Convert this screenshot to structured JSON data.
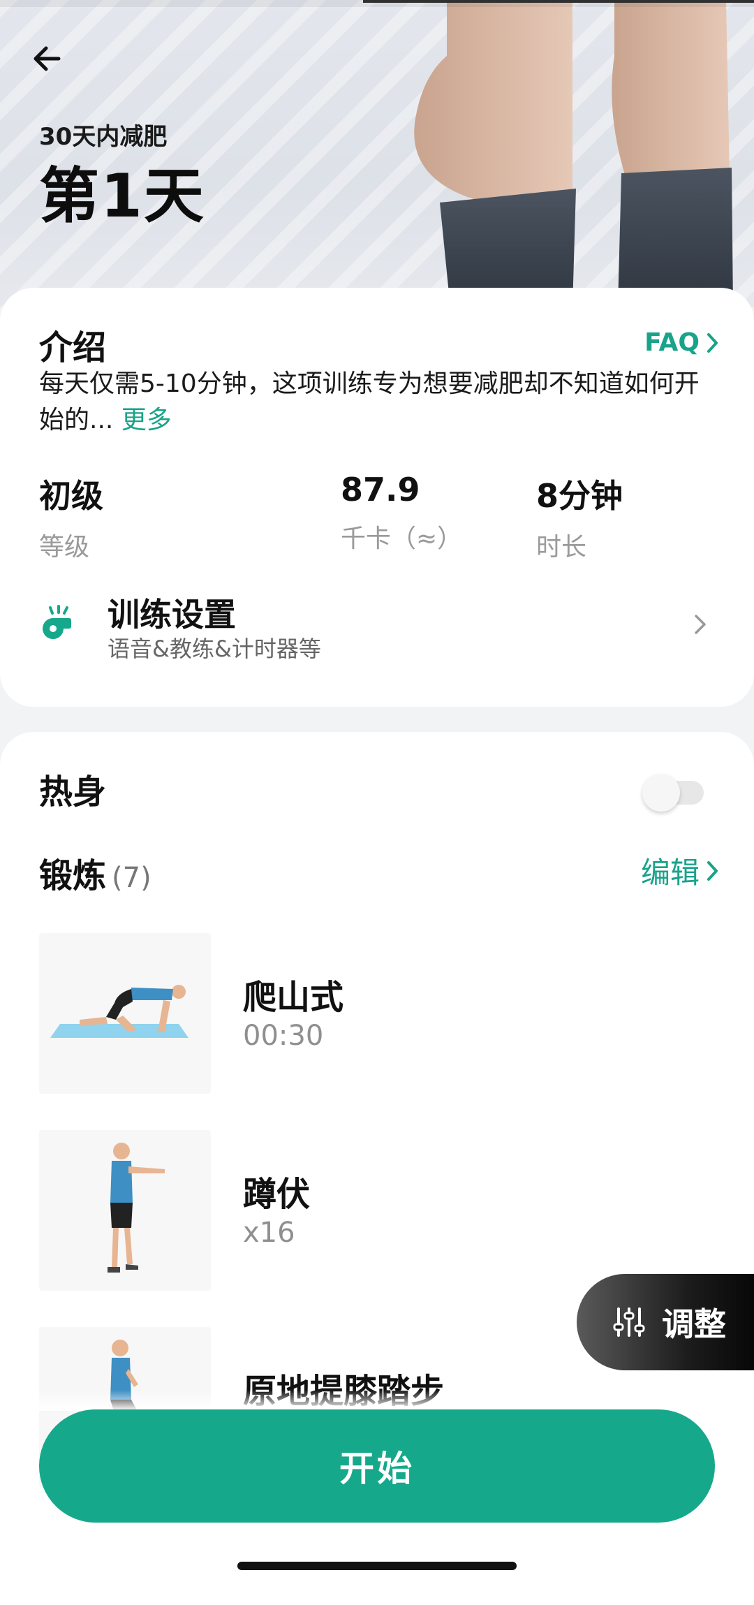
{
  "header": {
    "subtitle": "30天内减肥",
    "title": "第1天",
    "back_icon": "arrow-left-icon"
  },
  "intro": {
    "heading": "介绍",
    "faq_label": "FAQ",
    "text": "每天仅需5-10分钟，这项训练专为想要减肥却不知道如何开始的...",
    "more_label": "更多"
  },
  "stats": [
    {
      "value": "初级",
      "label": "等级"
    },
    {
      "value": "87.9",
      "label": "千卡（≈）"
    },
    {
      "value": "8分钟",
      "label": "时长"
    }
  ],
  "settings": {
    "title": "训练设置",
    "subtitle": "语音&教练&计时器等",
    "icon": "whistle-icon"
  },
  "warmup": {
    "label": "热身",
    "enabled": false
  },
  "workout": {
    "label": "锻炼",
    "count": "(7)",
    "edit_label": "编辑",
    "exercises": [
      {
        "name": "爬山式",
        "meta": "00:30"
      },
      {
        "name": "蹲伏",
        "meta": "x16"
      },
      {
        "name": "原地提膝踏步",
        "meta": ""
      }
    ]
  },
  "adjust": {
    "label": "调整",
    "icon": "sliders-icon"
  },
  "start_label": "开始",
  "colors": {
    "accent": "#16a88b",
    "pill_dark": "#1c1c1c"
  }
}
